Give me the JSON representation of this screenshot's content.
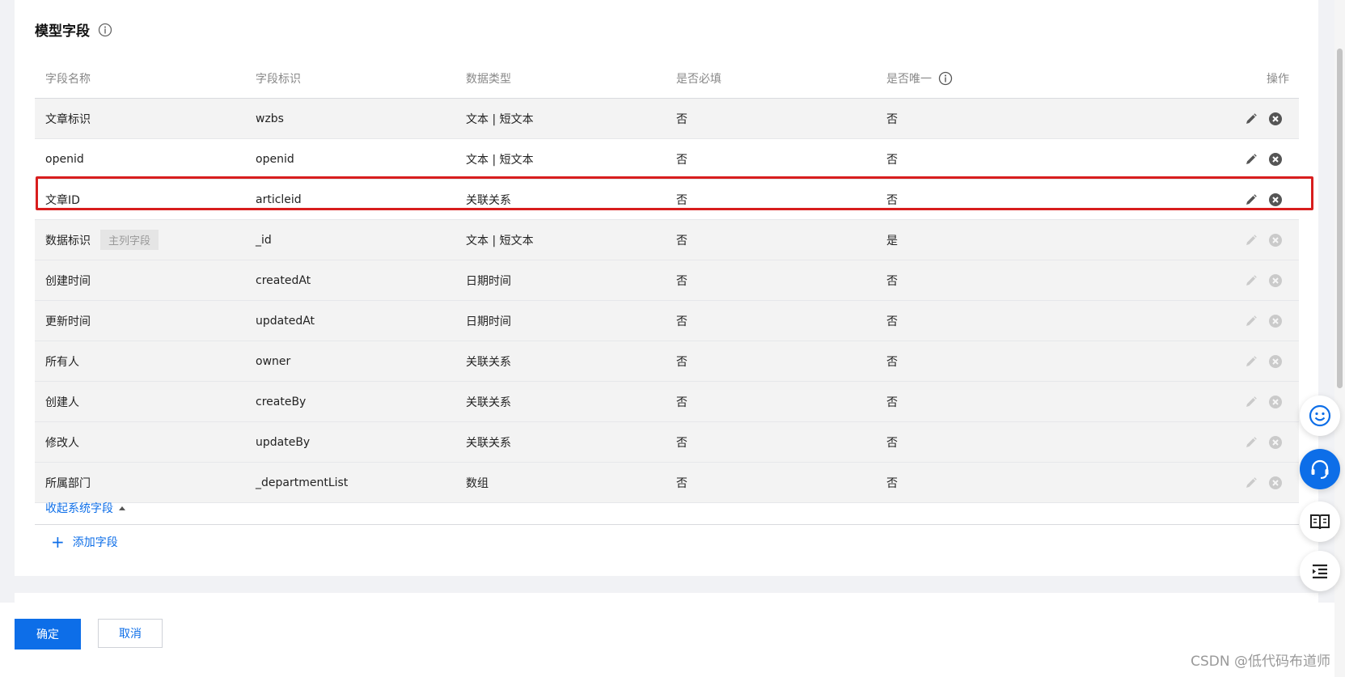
{
  "section": {
    "title": "模型字段"
  },
  "table": {
    "columns": [
      "字段名称",
      "字段标识",
      "数据类型",
      "是否必填",
      "是否唯一",
      "操作"
    ],
    "rows": [
      {
        "name": "文章标识",
        "key": "wzbs",
        "type": "文本 | 短文本",
        "required": "否",
        "unique": "否",
        "tag": ""
      },
      {
        "name": "openid",
        "key": "openid",
        "type": "文本 | 短文本",
        "required": "否",
        "unique": "否",
        "tag": ""
      },
      {
        "name": "文章ID",
        "key": "articleid",
        "type": "关联关系",
        "required": "否",
        "unique": "否",
        "tag": ""
      },
      {
        "name": "数据标识",
        "key": "_id",
        "type": "文本 | 短文本",
        "required": "否",
        "unique": "是",
        "tag": "主列字段"
      },
      {
        "name": "创建时间",
        "key": "createdAt",
        "type": "日期时间",
        "required": "否",
        "unique": "否",
        "tag": ""
      },
      {
        "name": "更新时间",
        "key": "updatedAt",
        "type": "日期时间",
        "required": "否",
        "unique": "否",
        "tag": ""
      },
      {
        "name": "所有人",
        "key": "owner",
        "type": "关联关系",
        "required": "否",
        "unique": "否",
        "tag": ""
      },
      {
        "name": "创建人",
        "key": "createBy",
        "type": "关联关系",
        "required": "否",
        "unique": "否",
        "tag": ""
      },
      {
        "name": "修改人",
        "key": "updateBy",
        "type": "关联关系",
        "required": "否",
        "unique": "否",
        "tag": ""
      },
      {
        "name": "所属部门",
        "key": "_departmentList",
        "type": "数组",
        "required": "否",
        "unique": "否",
        "tag": ""
      }
    ]
  },
  "collapse_label": "收起系统字段",
  "add_field_label": "添加字段",
  "footer": {
    "ok_label": "确定",
    "cancel_label": "取消"
  },
  "watermark": "CSDN @低代码布道师",
  "colors": {
    "primary": "#0d6ee8",
    "highlight": "#d81e1e"
  }
}
